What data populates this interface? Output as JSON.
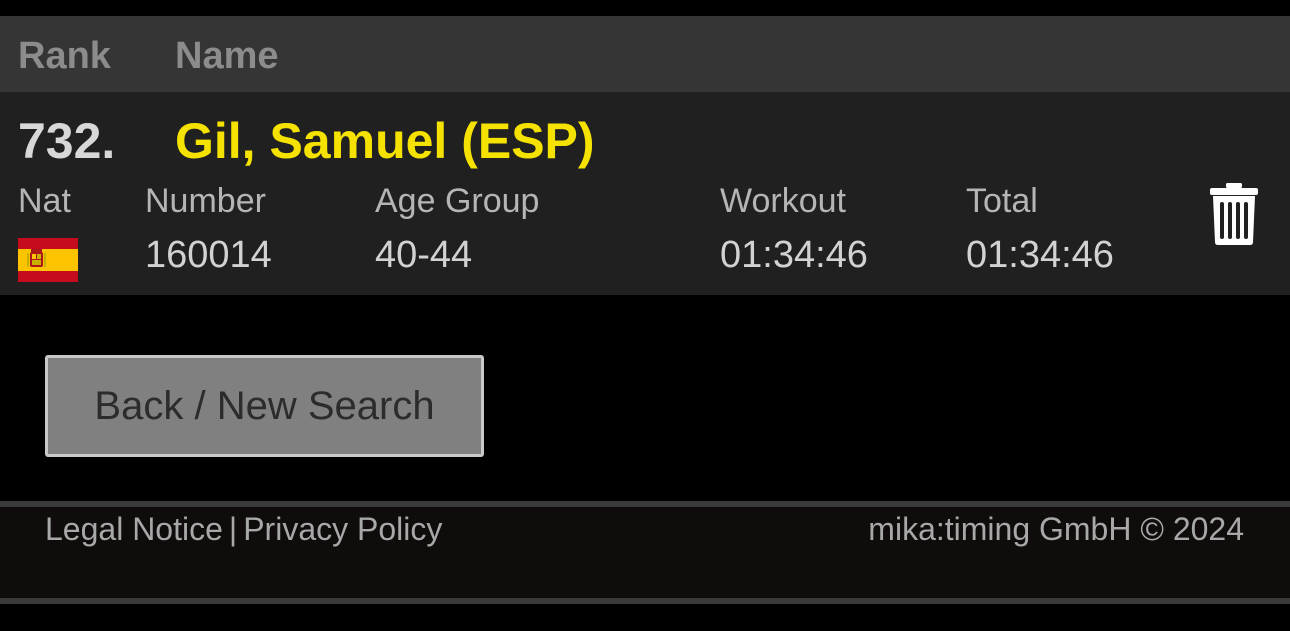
{
  "table_header": {
    "rank": "Rank",
    "name": "Name"
  },
  "result": {
    "rank": "732.",
    "name": "Gil, Samuel (ESP)",
    "labels": {
      "nat": "Nat",
      "number": "Number",
      "age_group": "Age Group",
      "workout": "Workout",
      "total": "Total"
    },
    "values": {
      "nat_flag": "spain-flag-icon",
      "number": "160014",
      "age_group": "40-44",
      "workout": "01:34:46",
      "total": "01:34:46"
    },
    "delete_icon": "trash-icon"
  },
  "back_button": {
    "label": "Back / New Search"
  },
  "footer": {
    "legal_notice": "Legal Notice",
    "separator": "|",
    "privacy_policy": "Privacy Policy",
    "copyright": "mika:timing GmbH © 2024"
  },
  "colors": {
    "name_highlight": "#f5e200",
    "header_bg": "#353535",
    "row_bg": "#202020",
    "button_bg": "#808080"
  }
}
